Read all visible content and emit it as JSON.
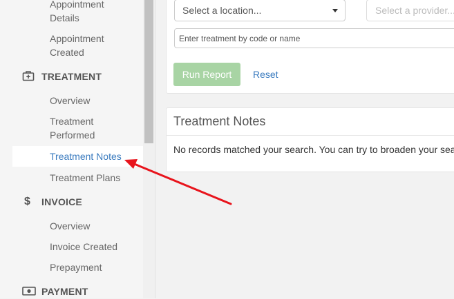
{
  "sidebar": {
    "appointment_details": [
      "Appointment",
      "Details"
    ],
    "appointment_created": [
      "Appointment",
      "Created"
    ],
    "treatment_section": "TREATMENT",
    "treatment_items": {
      "overview": "Overview",
      "performed": [
        "Treatment",
        "Performed"
      ],
      "notes": "Treatment Notes",
      "plans": "Treatment Plans"
    },
    "invoice_section": "INVOICE",
    "invoice_items": {
      "overview": "Overview",
      "created": "Invoice Created",
      "prepayment": "Prepayment"
    },
    "payment_section": "PAYMENT",
    "icons": {
      "treatment": "medical-kit-icon",
      "invoice": "dollar-icon",
      "payment": "cash-icon"
    }
  },
  "filters": {
    "location_placeholder": "Select a location...",
    "provider_placeholder": "Select a provider...",
    "treatment_placeholder": "Enter treatment by code or name"
  },
  "actions": {
    "run_report": "Run Report",
    "reset": "Reset"
  },
  "notes_panel": {
    "title": "Treatment Notes",
    "message": "No records matched your search. You can try to broaden your search"
  },
  "colors": {
    "accent_link": "#3a7bbf",
    "run_button": "#a8d4a4",
    "annotation_arrow": "#e8141c"
  }
}
